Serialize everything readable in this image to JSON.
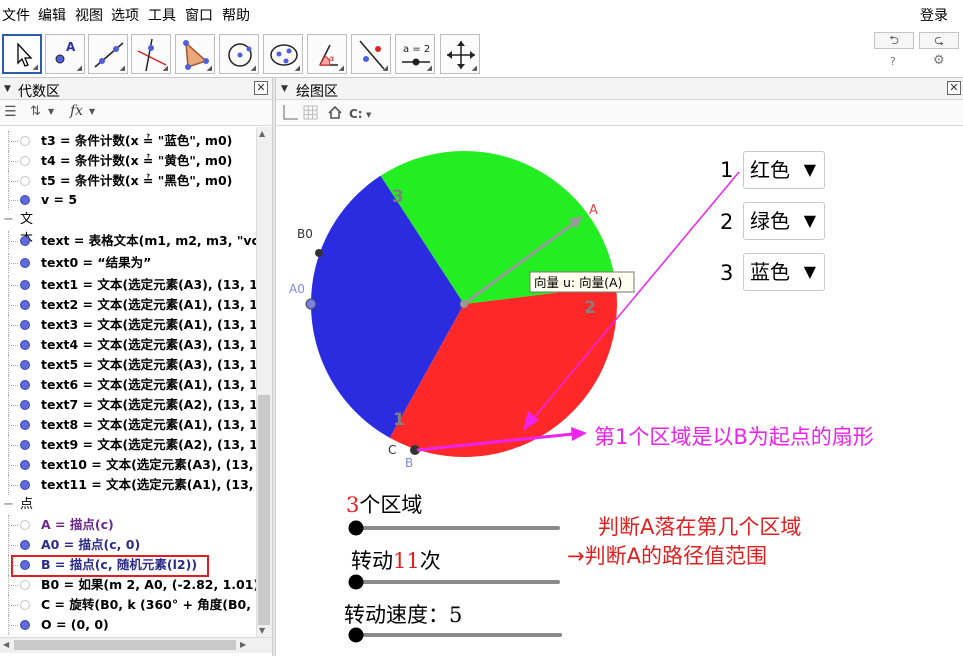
{
  "menu": {
    "items": [
      "文件",
      "编辑",
      "视图",
      "选项",
      "工具",
      "窗口",
      "帮助"
    ],
    "login": "登录"
  },
  "toolbar": {
    "tools": [
      {
        "name": "move-tool-icon",
        "active": true
      },
      {
        "name": "point-tool-icon"
      },
      {
        "name": "line-tool-icon"
      },
      {
        "name": "perpendicular-tool-icon"
      },
      {
        "name": "polygon-tool-icon"
      },
      {
        "name": "circle-tool-icon"
      },
      {
        "name": "ellipse-tool-icon"
      },
      {
        "name": "angle-tool-icon"
      },
      {
        "name": "reflect-tool-icon"
      },
      {
        "name": "slider-tool-icon",
        "label": "a = 2"
      },
      {
        "name": "move-view-tool-icon"
      }
    ],
    "undo_glyph": "⮌",
    "redo_glyph": "⮎",
    "help_glyph": "?",
    "settings_glyph": "⚙"
  },
  "algebra": {
    "title": "代数区",
    "sort_glyph": "⇅",
    "fx_glyph": "fx",
    "rows": [
      {
        "kind": "item",
        "dot": "empty",
        "text": "t3 = 条件计数(x ≟ \"蓝色\", m0)"
      },
      {
        "kind": "item",
        "dot": "empty",
        "text": "t4 = 条件计数(x ≟ \"黄色\", m0)"
      },
      {
        "kind": "item",
        "dot": "empty",
        "text": "t5 = 条件计数(x ≟ \"黑色\", m0)"
      },
      {
        "kind": "item",
        "dot": "filled",
        "text": "v = 5"
      },
      {
        "kind": "cat",
        "text": "文本"
      },
      {
        "kind": "item",
        "dot": "filled",
        "text": "text = 表格文本(m1, m2, m3, \"vc"
      },
      {
        "kind": "item",
        "dot": "filled",
        "text": "text0 = “结果为”"
      },
      {
        "kind": "item",
        "dot": "filled",
        "text": "text1 = 文本(选定元素(A3), (13, 1"
      },
      {
        "kind": "item",
        "dot": "filled",
        "text": "text2 = 文本(选定元素(A1), (13, 1"
      },
      {
        "kind": "item",
        "dot": "filled",
        "text": "text3 = 文本(选定元素(A1), (13, 1"
      },
      {
        "kind": "item",
        "dot": "filled",
        "text": "text4 = 文本(选定元素(A3), (13, 1"
      },
      {
        "kind": "item",
        "dot": "filled",
        "text": "text5 = 文本(选定元素(A3), (13, 1"
      },
      {
        "kind": "item",
        "dot": "filled",
        "text": "text6 = 文本(选定元素(A1), (13, 1"
      },
      {
        "kind": "item",
        "dot": "filled",
        "text": "text7 = 文本(选定元素(A2), (13, 1"
      },
      {
        "kind": "item",
        "dot": "filled",
        "text": "text8 = 文本(选定元素(A1), (13, 1"
      },
      {
        "kind": "item",
        "dot": "filled",
        "text": "text9 = 文本(选定元素(A2), (13, 1"
      },
      {
        "kind": "item",
        "dot": "filled",
        "text": "text10 = 文本(选定元素(A3), (13,"
      },
      {
        "kind": "item",
        "dot": "filled",
        "text": "text11 = 文本(选定元素(A1), (13,"
      },
      {
        "kind": "cat",
        "text": "点"
      },
      {
        "kind": "item",
        "dot": "empty",
        "text": "A = 描点(c)",
        "color": "purple"
      },
      {
        "kind": "item",
        "dot": "filled",
        "text": "A0 = 描点(c, 0)",
        "color": "navy"
      },
      {
        "kind": "item",
        "dot": "filled",
        "text": "B = 描点(c, 随机元素(l2))",
        "color": "navy"
      },
      {
        "kind": "item",
        "dot": "empty",
        "text": "B0 = 如果(m 2, A0, (-2.82, 1.01))"
      },
      {
        "kind": "item",
        "dot": "empty",
        "text": "C = 旋转(B0, k (360° + 角度(B0, ("
      },
      {
        "kind": "item",
        "dot": "filled",
        "text": "O = (0, 0)"
      }
    ]
  },
  "graphics": {
    "title": "绘图区",
    "pie": {
      "sectors": [
        {
          "label": "1",
          "color": "#2b2be0"
        },
        {
          "label": "2",
          "color": "#ff2828"
        },
        {
          "label": "3",
          "color": "#22ee22"
        }
      ],
      "points": {
        "A": "A",
        "A0": "A0",
        "B0": "B0",
        "B": "B",
        "C": "C"
      },
      "vector_tooltip": "向量 u: 向量(A)"
    },
    "dropdowns": [
      {
        "num": "1",
        "value": "红色"
      },
      {
        "num": "2",
        "value": "绿色"
      },
      {
        "num": "3",
        "value": "蓝色"
      }
    ],
    "sliders": [
      {
        "pre": "",
        "value": "3",
        "post": "个区域"
      },
      {
        "pre": "转动",
        "value": "11",
        "post": "次"
      },
      {
        "pre": "转动速度：5",
        "value": "",
        "post": ""
      }
    ],
    "annotations": {
      "sector_note": "第1个区域是以B为起点的扇形",
      "judge_note": "判断A落在第几个区域",
      "range_note": "→判断A的路径值范围"
    },
    "colors": {
      "magenta": "#ee22ee",
      "red": "#e02020"
    }
  }
}
